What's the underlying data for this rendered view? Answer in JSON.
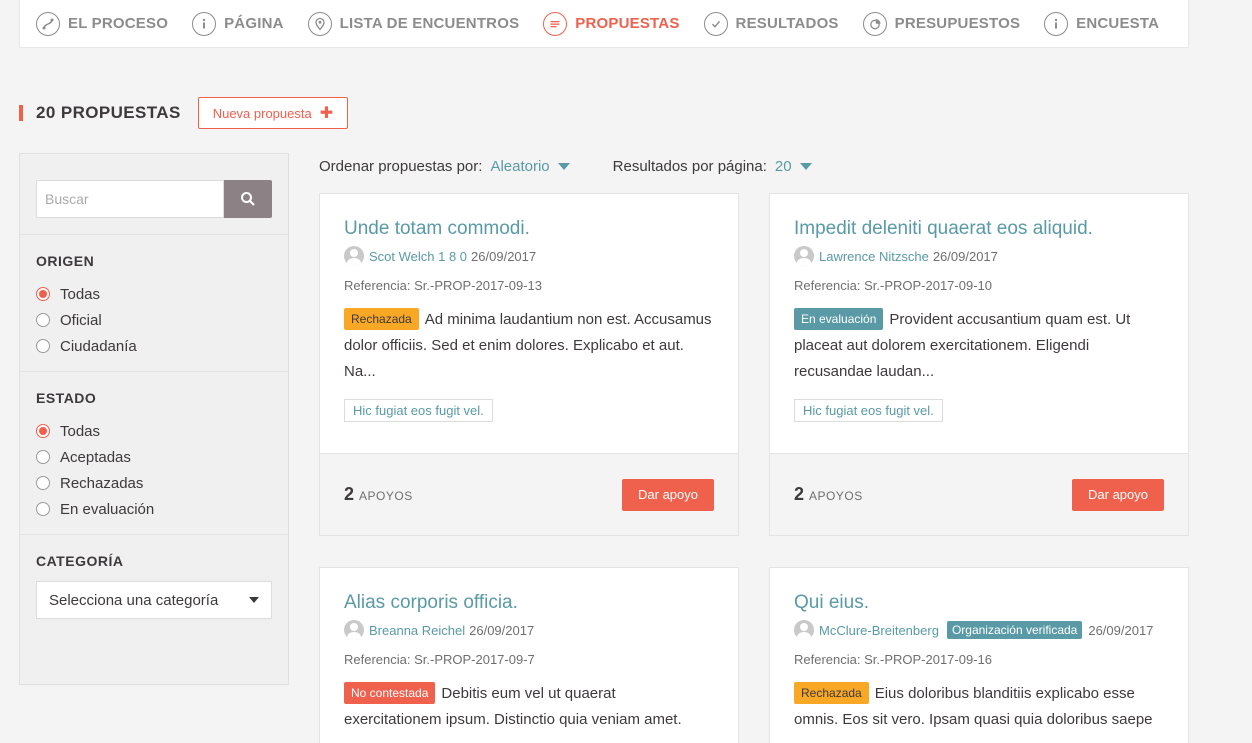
{
  "nav": [
    {
      "label": "EL PROCESO",
      "icon": "process-icon",
      "active": false
    },
    {
      "label": "PÁGINA",
      "icon": "info-icon",
      "active": false
    },
    {
      "label": "LISTA DE ENCUENTROS",
      "icon": "location-pin-icon",
      "active": false
    },
    {
      "label": "PROPUESTAS",
      "icon": "proposals-icon",
      "active": true
    },
    {
      "label": "RESULTADOS",
      "icon": "check-icon",
      "active": false
    },
    {
      "label": "PRESUPUESTOS",
      "icon": "pie-chart-icon",
      "active": false
    },
    {
      "label": "ENCUESTA",
      "icon": "info-icon",
      "active": false
    }
  ],
  "header": {
    "title": "20 PROPUESTAS",
    "new_button": "Nueva propuesta",
    "accent_color": "#ef604d"
  },
  "search": {
    "placeholder": "Buscar",
    "value": ""
  },
  "filters": {
    "origin": {
      "title": "ORIGEN",
      "options": [
        "Todas",
        "Oficial",
        "Ciudadanía"
      ],
      "selected": "Todas"
    },
    "state": {
      "title": "ESTADO",
      "options": [
        "Todas",
        "Aceptadas",
        "Rechazadas",
        "En evaluación"
      ],
      "selected": "Todas"
    },
    "category": {
      "title": "CATEGORÍA",
      "selected": "Selecciona una categoría"
    }
  },
  "order": {
    "label": "Ordenar propuestas por:",
    "value": "Aleatorio",
    "per_page_label": "Resultados por página:",
    "per_page_value": "20"
  },
  "proposals": [
    {
      "title": "Unde totam commodi.",
      "author": "Scot Welch 1 8 0",
      "date": "26/09/2017",
      "reference": "Referencia: Sr.-PROP-2017-09-13",
      "status": "Rechazada",
      "body": "Ad minima laudantium non est. Accusamus dolor officiis. Sed et enim dolores. Explicabo et aut. Na...",
      "tag": "Hic fugiat eos fugit vel.",
      "supports": "2",
      "supports_label": "APOYOS",
      "button": "Dar apoyo"
    },
    {
      "title": "Impedit deleniti quaerat eos aliquid.",
      "author": "Lawrence Nitzsche",
      "date": "26/09/2017",
      "reference": "Referencia: Sr.-PROP-2017-09-10",
      "status": "En evaluación",
      "body": "Provident accusantium quam est. Ut placeat aut dolorem exercitationem. Eligendi recusandae laudan...",
      "tag": "Hic fugiat eos fugit vel.",
      "supports": "2",
      "supports_label": "APOYOS",
      "button": "Dar apoyo"
    },
    {
      "title": "Alias corporis officia.",
      "author": "Breanna Reichel",
      "date": "26/09/2017",
      "reference": "Referencia: Sr.-PROP-2017-09-7",
      "status": "No contestada",
      "body": "Debitis eum vel ut quaerat exercitationem ipsum. Distinctio quia veniam amet."
    },
    {
      "title": "Qui eius.",
      "author": "McClure-Breitenberg",
      "badge": "Organización verificada",
      "date": "26/09/2017",
      "reference": "Referencia: Sr.-PROP-2017-09-16",
      "status": "Rechazada",
      "body": "Eius doloribus blanditiis explicabo esse omnis. Eos sit vero. Ipsam quasi quia doloribus saepe"
    }
  ]
}
